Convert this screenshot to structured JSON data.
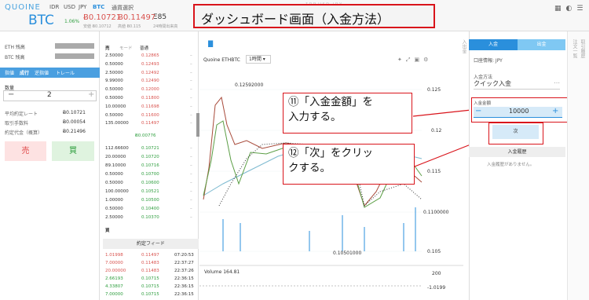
{
  "header": {
    "logo": "QUOINE",
    "currencies": [
      "IDR",
      "USD",
      "JPY",
      "BTC"
    ],
    "pair_select": "通貨選択",
    "pair": "BTC",
    "change_pct": "1.06%",
    "bid": "Ƀ0.10721",
    "ask": "Ƀ0.11497",
    "volume": "Ξ85",
    "bid_label": "安値 Ƀ0.10712",
    "ask_label": "高値 Ƀ0.115",
    "vol_label": "24時間出来高"
  },
  "banner": {
    "title": "ダッシュボード画面（入金方法）",
    "sub": "ＩＤＲ ＵＳＤ ＪＰＹ"
  },
  "left": {
    "eth_label": "ETH 残高",
    "btc_label": "BTC 残高",
    "tabs": [
      "指値",
      "成行",
      "逆指値",
      "トレール"
    ],
    "qty_label": "数量",
    "qty_value": "2",
    "rows": [
      {
        "label": "平均約定レート",
        "value": "Ƀ0.10721"
      },
      {
        "label": "取引手数料",
        "value": "Ƀ0.00054"
      },
      {
        "label": "約定代金（概算）",
        "value": "Ƀ0.21496"
      }
    ],
    "sell": "売",
    "buy": "買"
  },
  "orderbook": {
    "header_sell": "売",
    "header_mode": "モード",
    "header_mode_value": "普通",
    "asks": [
      {
        "qty": "2.50000",
        "price": "0.12865"
      },
      {
        "qty": "0.50000",
        "price": "0.12493"
      },
      {
        "qty": "2.50000",
        "price": "0.12492"
      },
      {
        "qty": "9.99000",
        "price": "0.12490"
      },
      {
        "qty": "0.50000",
        "price": "0.12000"
      },
      {
        "qty": "0.50000",
        "price": "0.11800"
      },
      {
        "qty": "10.00000",
        "price": "0.11698"
      },
      {
        "qty": "0.50000",
        "price": "0.11600"
      },
      {
        "qty": "135.00000",
        "price": "0.11497"
      }
    ],
    "spread": "Ƀ0.00776",
    "bids": [
      {
        "qty": "112.66600",
        "price": "0.10721"
      },
      {
        "qty": "20.00000",
        "price": "0.10720"
      },
      {
        "qty": "89.10000",
        "price": "0.10716"
      },
      {
        "qty": "0.50000",
        "price": "0.10700"
      },
      {
        "qty": "0.50000",
        "price": "0.10600"
      },
      {
        "qty": "100.00000",
        "price": "0.10521"
      },
      {
        "qty": "1.00000",
        "price": "0.10500"
      },
      {
        "qty": "0.50000",
        "price": "0.10400"
      },
      {
        "qty": "2.50000",
        "price": "0.10370"
      }
    ],
    "buy_label": "買",
    "feed_title": "約定フィード",
    "feed": [
      {
        "qty": "1.01998",
        "price": "0.11497",
        "time": "07:20:53"
      },
      {
        "qty": "7.00000",
        "price": "0.11483",
        "time": "22:37:27"
      },
      {
        "qty": "20.00000",
        "price": "0.11483",
        "time": "22:37:26"
      },
      {
        "qty": "2.66193",
        "price": "0.10715",
        "time": "22:36:15"
      },
      {
        "qty": "4.33807",
        "price": "0.10715",
        "time": "22:36:15"
      },
      {
        "qty": "7.00000",
        "price": "0.10715",
        "time": "22:36:15"
      }
    ]
  },
  "chart": {
    "pair_label": "Quoine ETHBTC",
    "interval": "1時間",
    "high_label": "0.12592000",
    "low_label": "0.10501000",
    "yticks": [
      "0.125",
      "0.12",
      "0.115",
      "0.1100000",
      "0.105"
    ],
    "volume_label": "Volume 164.81",
    "vol_ticks": [
      "200",
      "-1.0199"
    ]
  },
  "callouts": {
    "c11_line1": "⑪「入金金額」を",
    "c11_line2": "入力する。",
    "c12_line1": "⑫「次」をクリッ",
    "c12_line2": "クする。"
  },
  "right": {
    "deposit_tab": "入金",
    "withdraw_tab": "出金",
    "account_label": "口座情報: JPY",
    "method_label": "入金方法",
    "method_value": "クイック入金",
    "amount_label": "入金金額",
    "amount_value": "10000",
    "next": "次",
    "history_title": "入金履歴",
    "history_empty": "入金履歴がありません。"
  },
  "side": {
    "labels": [
      "注文一覧",
      "取引履歴",
      "入出金"
    ]
  },
  "colors": {
    "accent": "#2a8fdc",
    "sell": "#d9534f",
    "buy": "#2e9e3e",
    "callout": "#d9141b"
  }
}
